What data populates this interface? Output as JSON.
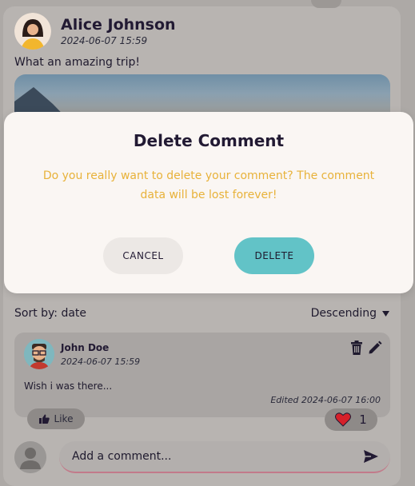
{
  "post": {
    "author": "Alice Johnson",
    "timestamp": "2024-06-07 15:59",
    "text": "What an amazing trip!"
  },
  "sort": {
    "label": "Sort by: date",
    "order": "Descending"
  },
  "comment": {
    "author": "John Doe",
    "timestamp": "2024-06-07 15:59",
    "text": "Wish i was there...",
    "edited": "Edited 2024-06-07 16:00"
  },
  "reactions": {
    "like_label": "Like",
    "heart_count": "1"
  },
  "input": {
    "placeholder": "Add a comment..."
  },
  "modal": {
    "title": "Delete Comment",
    "message": "Do you really want to delete your comment? The comment data will be lost forever!",
    "cancel_label": "CANCEL",
    "delete_label": "DELETE"
  },
  "colors": {
    "accent": "#62c3c7",
    "warning_text": "#e8b23a",
    "heart": "#d6202a"
  }
}
